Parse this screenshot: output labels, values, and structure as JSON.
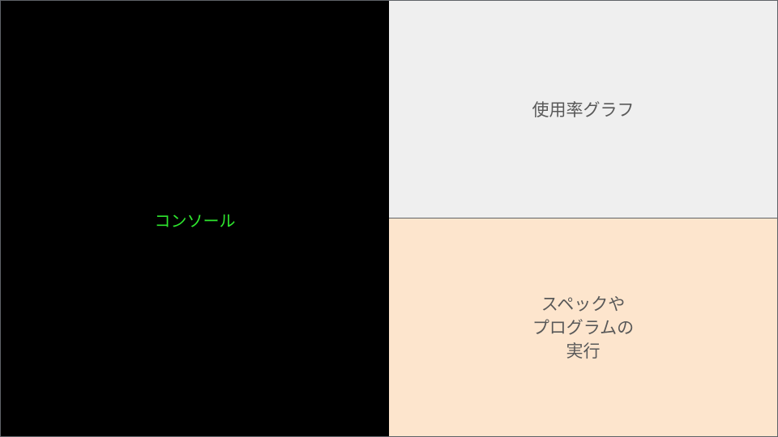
{
  "panels": {
    "console": {
      "label": "コンソール",
      "background": "#000000",
      "text_color": "#2ee62e"
    },
    "usage_graph": {
      "label": "使用率グラフ",
      "background": "#efefef",
      "text_color": "#595959"
    },
    "spec": {
      "lines": [
        "スペックや",
        "プログラムの",
        "実行"
      ],
      "background": "#fde5cd",
      "text_color": "#595959"
    }
  }
}
